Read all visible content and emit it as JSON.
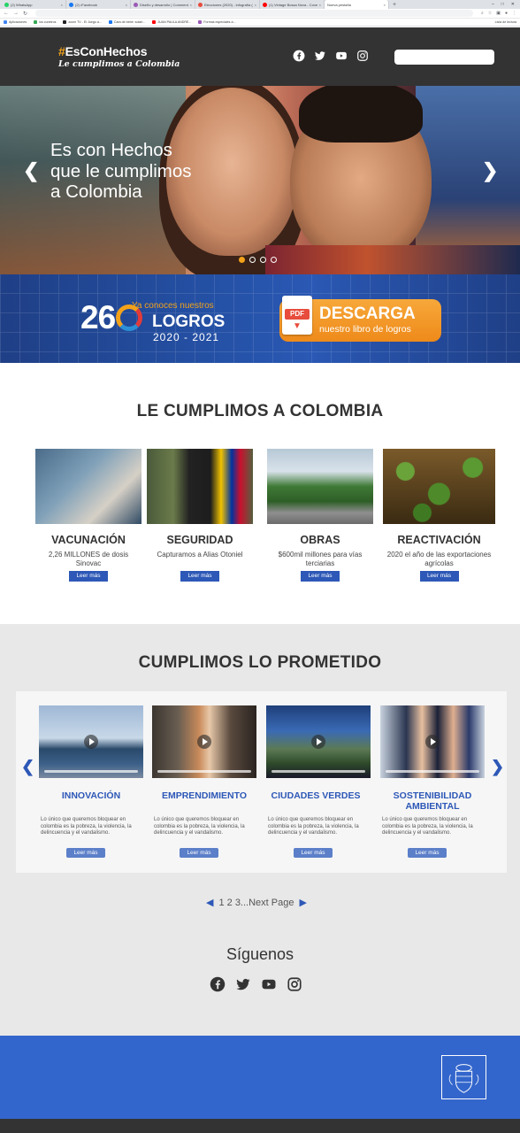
{
  "browser": {
    "tabs": [
      {
        "label": "(2) WhatsApp",
        "color": "#25d366"
      },
      {
        "label": "(2) •Facebook",
        "color": "#1877f2"
      },
      {
        "label": "Diseño y desarrollo | Comment Co...",
        "color": "#9b59b6"
      },
      {
        "label": "Elecciones (2020) - infografía (B)...",
        "color": "#e74c3c"
      },
      {
        "label": "(1) Vintage Bossa Nova - Covers...",
        "color": "#ff0000"
      },
      {
        "label": "Nueva pestaña",
        "color": "#5f6368"
      }
    ],
    "bookmarks": [
      {
        "label": "Aplicaciones",
        "color": "#4285f4"
      },
      {
        "label": "los cuneiros",
        "color": "#34a853"
      },
      {
        "label": "zoom TV - El Juego a...",
        "color": "#202124"
      },
      {
        "label": "Cara de bebé: solari...",
        "color": "#1877f2"
      },
      {
        "label": "JUAN PAULA ANDRE...",
        "color": "#ff0000"
      },
      {
        "label": "Formas especiales a...",
        "color": "#9b59b6"
      }
    ],
    "reading_list": "Lista de lectura"
  },
  "header": {
    "logo_hash": "#",
    "logo_main": "EsConHechos",
    "logo_sub": "Le cumplimos a Colombia",
    "social_icons": [
      "facebook-icon",
      "twitter-icon",
      "youtube-icon",
      "instagram-icon"
    ]
  },
  "hero": {
    "line1": "Es con Hechos",
    "line2": "que le cumplimos",
    "line3": "a Colombia",
    "prev": "❮",
    "next": "❯",
    "active_slide": 1,
    "slides": 4
  },
  "banner": {
    "num_left": "26",
    "ya_conoces": "Ya conoces nuestros",
    "logros": "LOGROS",
    "years": "2020 - 2021",
    "pdf": "PDF",
    "descarga": "DESCARGA",
    "libro": "nuestro libro de logros"
  },
  "le_cumplimos": {
    "title": "LE CUMPLIMOS A COLOMBIA",
    "cards": [
      {
        "title": "VACUNACIÓN",
        "desc": "2,26 MILLONES de dosis Sinovac",
        "button": "Leer más"
      },
      {
        "title": "SEGURIDAD",
        "desc": "Capturamos a Alias Otoniel",
        "button": "Leer más"
      },
      {
        "title": "OBRAS",
        "desc": "$600mil millones para vías terciarias",
        "button": "Leer más"
      },
      {
        "title": "REACTIVACIÓN",
        "desc": "2020 el año de las exportaciones agrícolas",
        "button": "Leer más"
      }
    ]
  },
  "prometido": {
    "title": "CUMPLIMOS LO PROMETIDO",
    "prev": "❮",
    "next": "❯",
    "cards": [
      {
        "title": "INNOVACIÓN",
        "desc": "Lo único que queremos bloquear en colombia es la pobreza, la violencia, la delincuencia y el vandalismo.",
        "button": "Leer más"
      },
      {
        "title": "EMPRENDIMIENTO",
        "desc": "Lo único que queremos bloquear en colombia es la pobreza, la violencia, la delincuencia y el vandalismo.",
        "button": "Leer más"
      },
      {
        "title": "CIUDADES VERDES",
        "desc": "Lo único que queremos bloquear en colombia es la pobreza, la violencia, la delincuencia y el vandalismo.",
        "button": "Leer más"
      },
      {
        "title": "SOSTENIBILIDAD AMBIENTAL",
        "desc": "Lo único que queremos bloquear en colombia es la pobreza, la violencia, la delincuencia y el vandalismo.",
        "button": "Leer más"
      }
    ]
  },
  "pager": {
    "prev": "◀",
    "text": "1 2 3...Next Page",
    "next": "▶"
  },
  "siguenos": {
    "title": "Síguenos",
    "social_icons": [
      "facebook-icon",
      "twitter-icon",
      "youtube-icon",
      "instagram-icon"
    ]
  },
  "colors": {
    "header_bg": "#333333",
    "accent_orange": "#f3a21a",
    "brand_blue": "#2d58b7",
    "footer_blue": "#3366cc"
  }
}
